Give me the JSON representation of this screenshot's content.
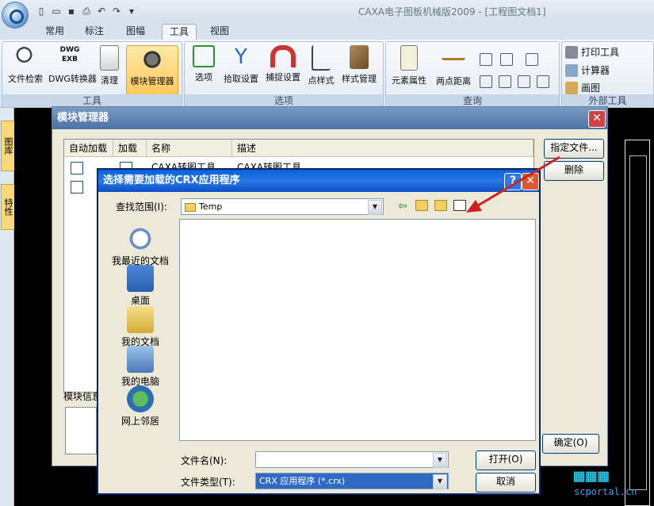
{
  "app": {
    "title": "CAXA电子图板机械版2009 - [工程图文档1]",
    "tabs": [
      "常用",
      "标注",
      "图幅",
      "工具",
      "视图"
    ],
    "active_tab": "工具"
  },
  "ribbon": {
    "groups": {
      "tools": {
        "label": "工具",
        "buttons": [
          "文件检索",
          "DWG转换器",
          "清理",
          "模块管理器"
        ],
        "dwg_icon_text": [
          "DWG",
          "EXB"
        ]
      },
      "options": {
        "label": "选项",
        "buttons": [
          "选项",
          "拾取设置",
          "捕捉设置",
          "点样式",
          "样式管理"
        ]
      },
      "query": {
        "label": "查询",
        "buttons": [
          "元素属性",
          "两点距离"
        ]
      },
      "external": {
        "label": "外部工具",
        "buttons": [
          "打印工具",
          "计算器",
          "画图"
        ]
      }
    }
  },
  "side_tabs": [
    "图库",
    "特性"
  ],
  "module_manager": {
    "title": "模块管理器",
    "columns": [
      "自动加载",
      "加载",
      "名称",
      "描述"
    ],
    "rows": [
      {
        "name": "CAXA转图工具",
        "desc": "CAXA转图工具"
      },
      {
        "name": "",
        "desc": ""
      }
    ],
    "buttons": {
      "specify": "指定文件...",
      "delete": "删除",
      "ok": "确定(O)"
    },
    "info_label": "模块信息"
  },
  "file_dialog": {
    "title": "选择需要加载的CRX应用程序",
    "look_in_label": "查找范围(I):",
    "look_in_value": "Temp",
    "places": [
      "我最近的文档",
      "桌面",
      "我的文档",
      "我的电脑",
      "网上邻居"
    ],
    "filename_label": "文件名(N):",
    "filename_value": "",
    "filetype_label": "文件类型(T):",
    "filetype_value": "CRX 应用程序 (*.crx)",
    "open_button": "打开(O)",
    "cancel_button": "取消"
  },
  "watermark": "scportal.cn"
}
